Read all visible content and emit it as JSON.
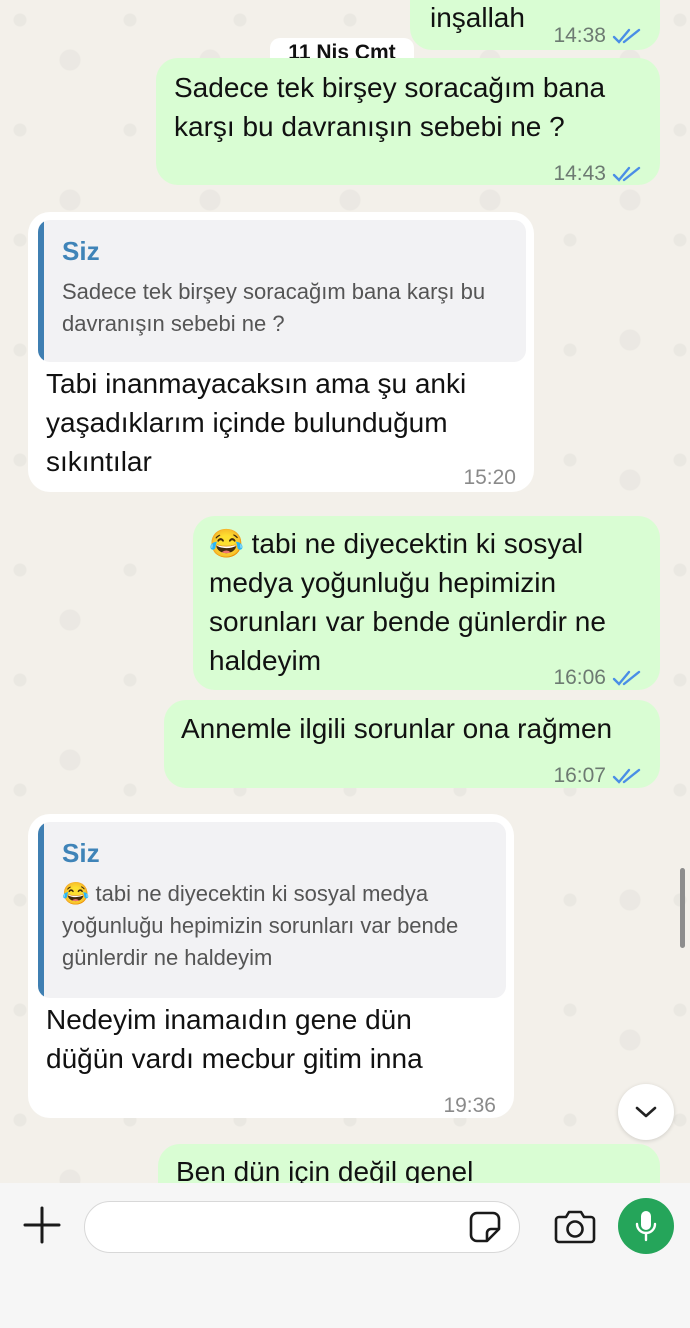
{
  "date_separator": "11 Nis Cmt",
  "messages": [
    {
      "direction": "out",
      "text": "inşallah",
      "time": "14:38"
    },
    {
      "direction": "out",
      "text": "Sadece tek birşey soracağım bana karşı bu davranışın sebebi ne ?",
      "time": "14:43"
    },
    {
      "direction": "in",
      "quote_name": "Siz",
      "quote_text": "Sadece tek birşey soracağım bana karşı bu davranışın sebebi ne ?",
      "text": "Tabi inanmayacaksın ama şu anki yaşadıklarım içinde bulunduğum sıkıntılar",
      "time": "15:20"
    },
    {
      "direction": "out",
      "text": "😂 tabi ne diyecektin ki sosyal medya yoğunluğu hepimizin sorunları var bende günlerdir ne haldeyim",
      "time": "16:06"
    },
    {
      "direction": "out",
      "text": "Annemle ilgili sorunlar ona rağmen",
      "time": "16:07"
    },
    {
      "direction": "in",
      "quote_name": "Siz",
      "quote_text": "😂 tabi ne diyecektin ki sosyal medya yoğunluğu hepimizin sorunları var bende günlerdir ne haldeyim",
      "text": "Nedeyim inamaıdın gene dün düğün vardı mecbur gitim inna",
      "time": "19:36"
    },
    {
      "direction": "out",
      "text": "Ben dün için değil genel",
      "time": ""
    }
  ],
  "composer": {
    "placeholder": "",
    "value": ""
  },
  "icons": {
    "attach": "plus-icon",
    "sticker": "sticker-icon",
    "camera": "camera-icon",
    "mic": "microphone-icon",
    "scroll_down": "chevron-down-icon",
    "read_receipt": "double-check-icon"
  },
  "colors": {
    "outgoing_bubble": "#d9fdd3",
    "incoming_bubble": "#ffffff",
    "quote_accent": "#3f7fb2",
    "read_ticks": "#4a8ee6",
    "mic_button": "#25a55a"
  }
}
